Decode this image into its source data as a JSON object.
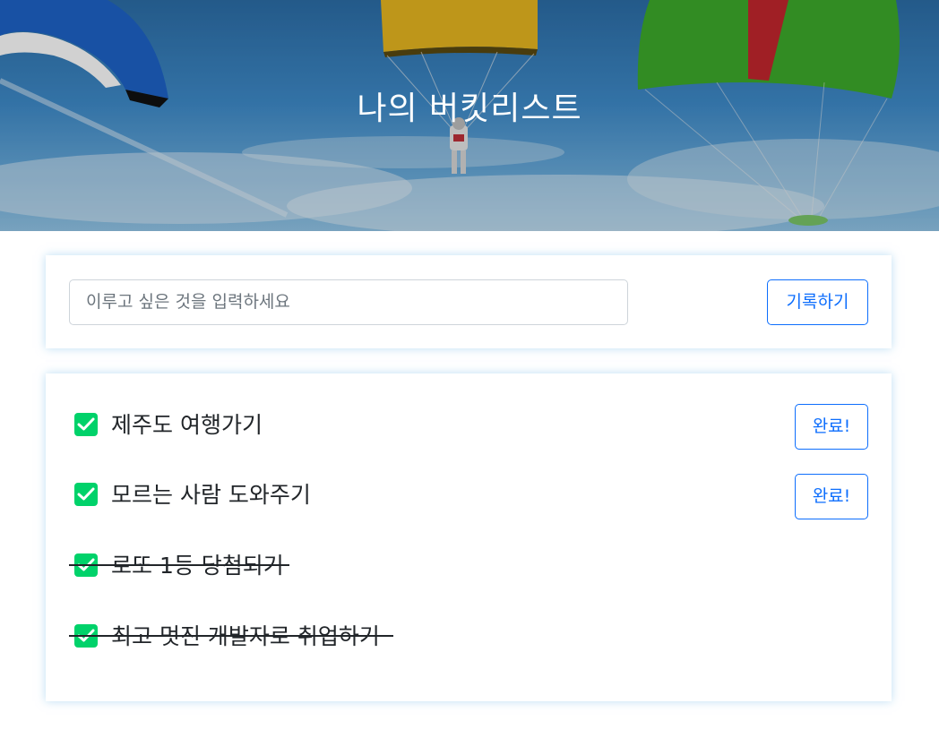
{
  "header": {
    "title": "나의 버킷리스트"
  },
  "form": {
    "placeholder": "이루고 싶은 것을 입력하세요",
    "submit_label": "기록하기"
  },
  "list": {
    "items": [
      {
        "text": "제주도 여행가기",
        "done": false,
        "button_label": "완료!"
      },
      {
        "text": "모르는 사람 도와주기",
        "done": false,
        "button_label": "완료!"
      },
      {
        "text": "로또 1등 당첨되기",
        "done": true
      },
      {
        "text": "최고 멋진 개발자로 취업하기",
        "done": true
      }
    ]
  },
  "colors": {
    "accent": "#0d6efd",
    "checkbox": "#00d26a",
    "sky": "#3f8ccb"
  },
  "icons": {
    "checkbox": "check-icon"
  }
}
